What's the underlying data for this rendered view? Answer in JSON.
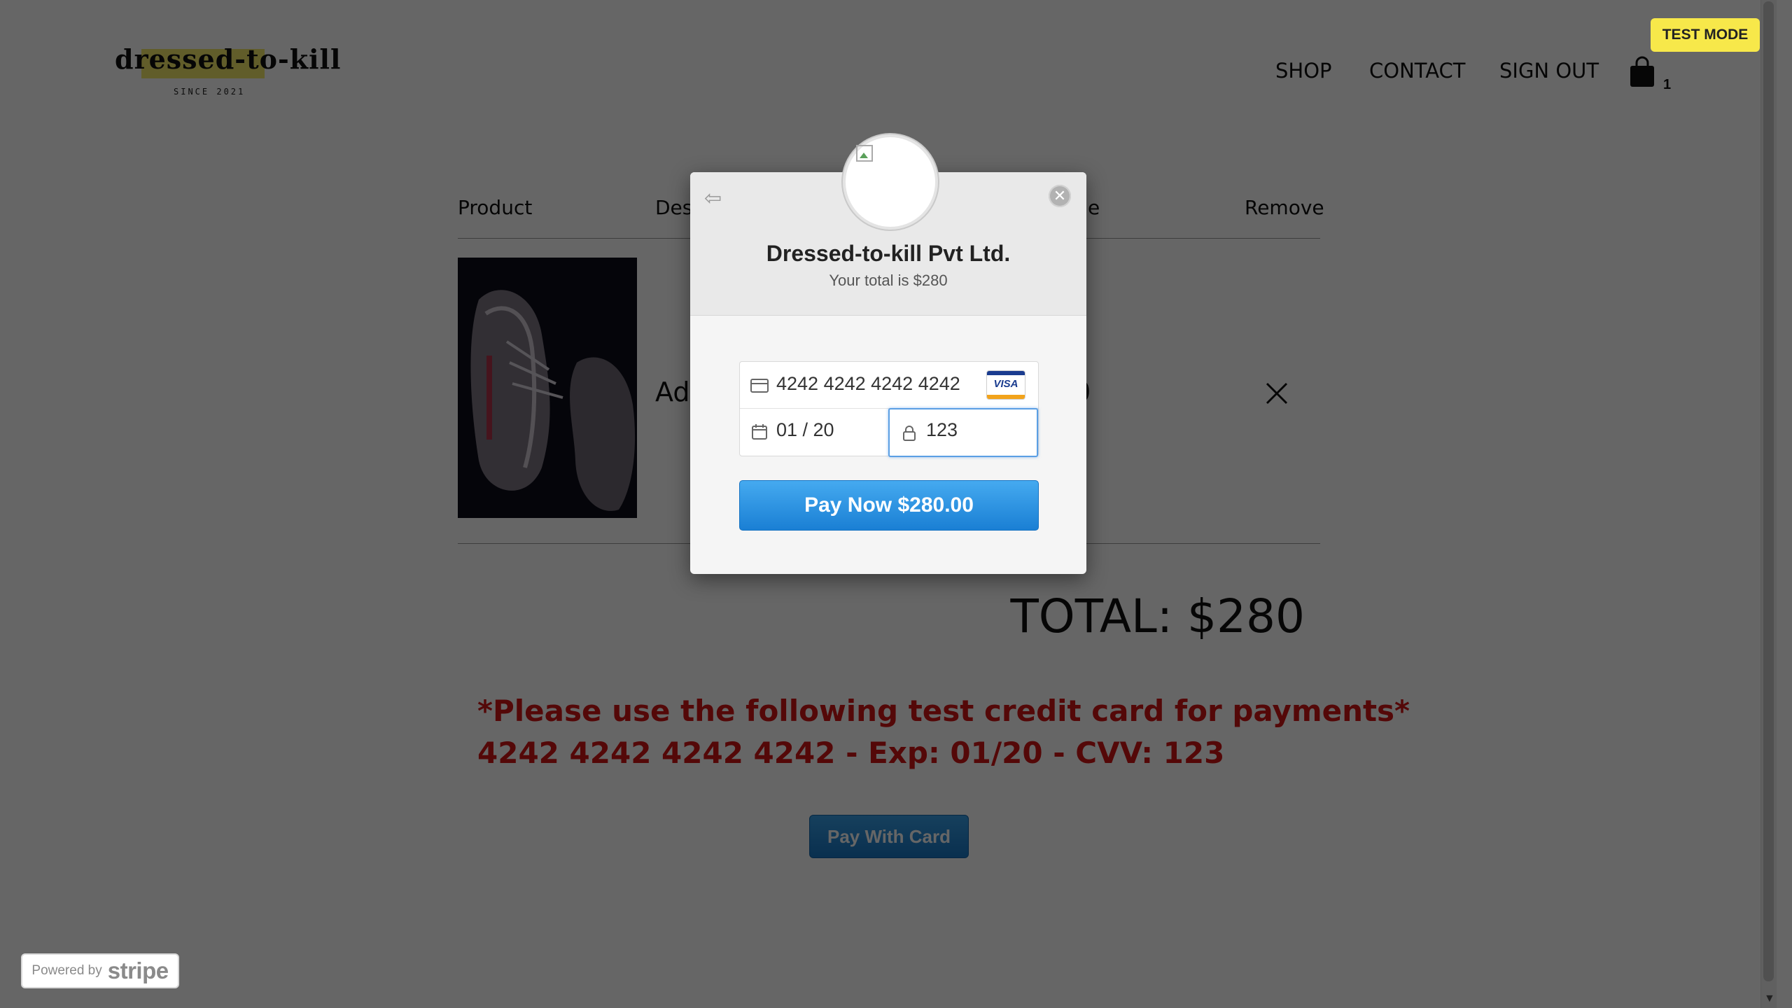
{
  "header": {
    "logo_text": "dressed-to-kill",
    "logo_since": "SINCE 2021",
    "nav": {
      "shop": "SHOP",
      "contact": "CONTACT",
      "sign_out": "SIGN OUT"
    },
    "cart_count": "1",
    "test_mode": "TEST MODE"
  },
  "cart": {
    "columns": {
      "product": "Product",
      "description_partial": "Des",
      "price_partial": "e",
      "remove": "Remove"
    },
    "item": {
      "name_partial": "Ad",
      "price_partial": "0"
    },
    "total": "TOTAL: $280"
  },
  "notice": {
    "line1": "*Please use the following test credit card for payments*",
    "line2": "4242 4242 4242 4242 - Exp: 01/20 - CVV: 123"
  },
  "pay_with_card": "Pay With Card",
  "powered_by": {
    "prefix": "Powered by",
    "brand": "stripe"
  },
  "modal": {
    "merchant": "Dressed-to-kill Pvt Ltd.",
    "subtitle": "Your total is $280",
    "card_number": "4242 4242 4242 4242",
    "card_brand": "VISA",
    "expiry": "01 / 20",
    "cvc": "123",
    "pay_button": "Pay Now $280.00"
  },
  "colors": {
    "notice_red": "#d21616",
    "stripe_blue": "#1a7fd4",
    "test_mode_yellow": "#f7e84a",
    "logo_highlight": "#f3e96a"
  }
}
